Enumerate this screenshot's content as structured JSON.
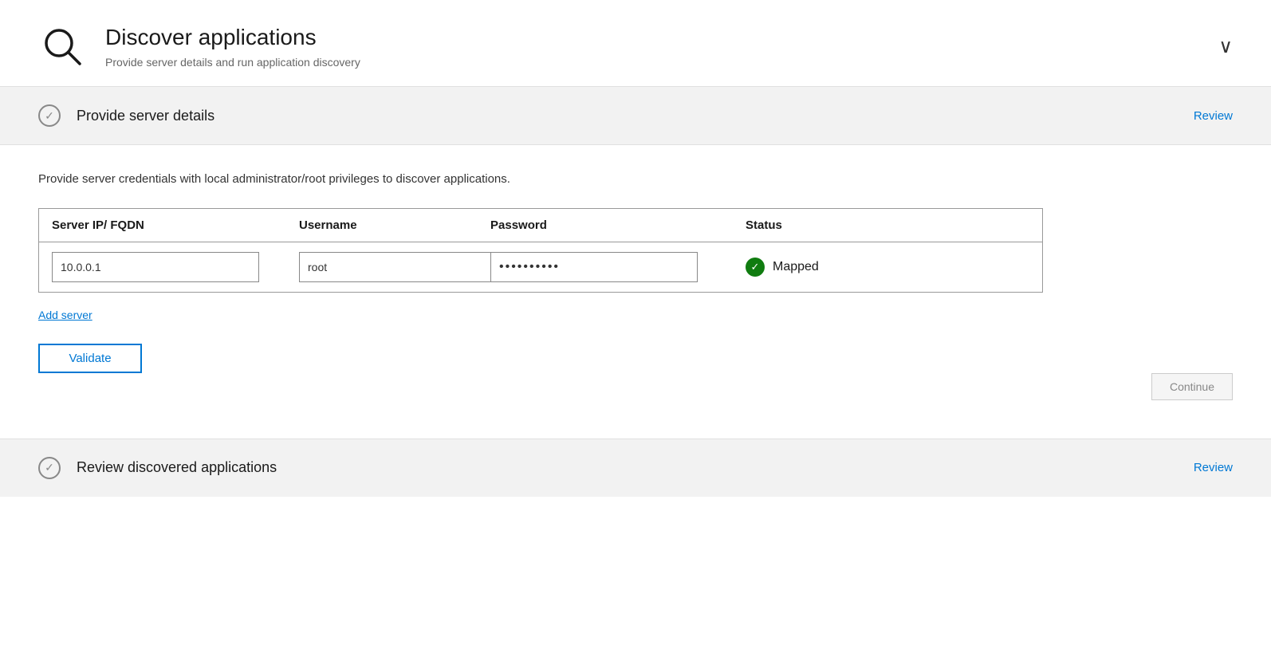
{
  "header": {
    "title": "Discover applications",
    "subtitle": "Provide server details and run application discovery",
    "chevron": "∨"
  },
  "step1": {
    "check_icon": "✓",
    "title": "Provide server details",
    "review_label": "Review",
    "description": "Provide server credentials with local administrator/root privileges to discover applications.",
    "table": {
      "columns": [
        "Server IP/ FQDN",
        "Username",
        "Password",
        "Status"
      ],
      "rows": [
        {
          "server_ip": "10.0.0.1",
          "username": "root",
          "password": "••••••••••",
          "status": "Mapped"
        }
      ]
    },
    "add_server_label": "Add server",
    "validate_label": "Validate",
    "continue_label": "Continue"
  },
  "step2": {
    "check_icon": "✓",
    "title": "Review discovered applications",
    "review_label": "Review"
  }
}
